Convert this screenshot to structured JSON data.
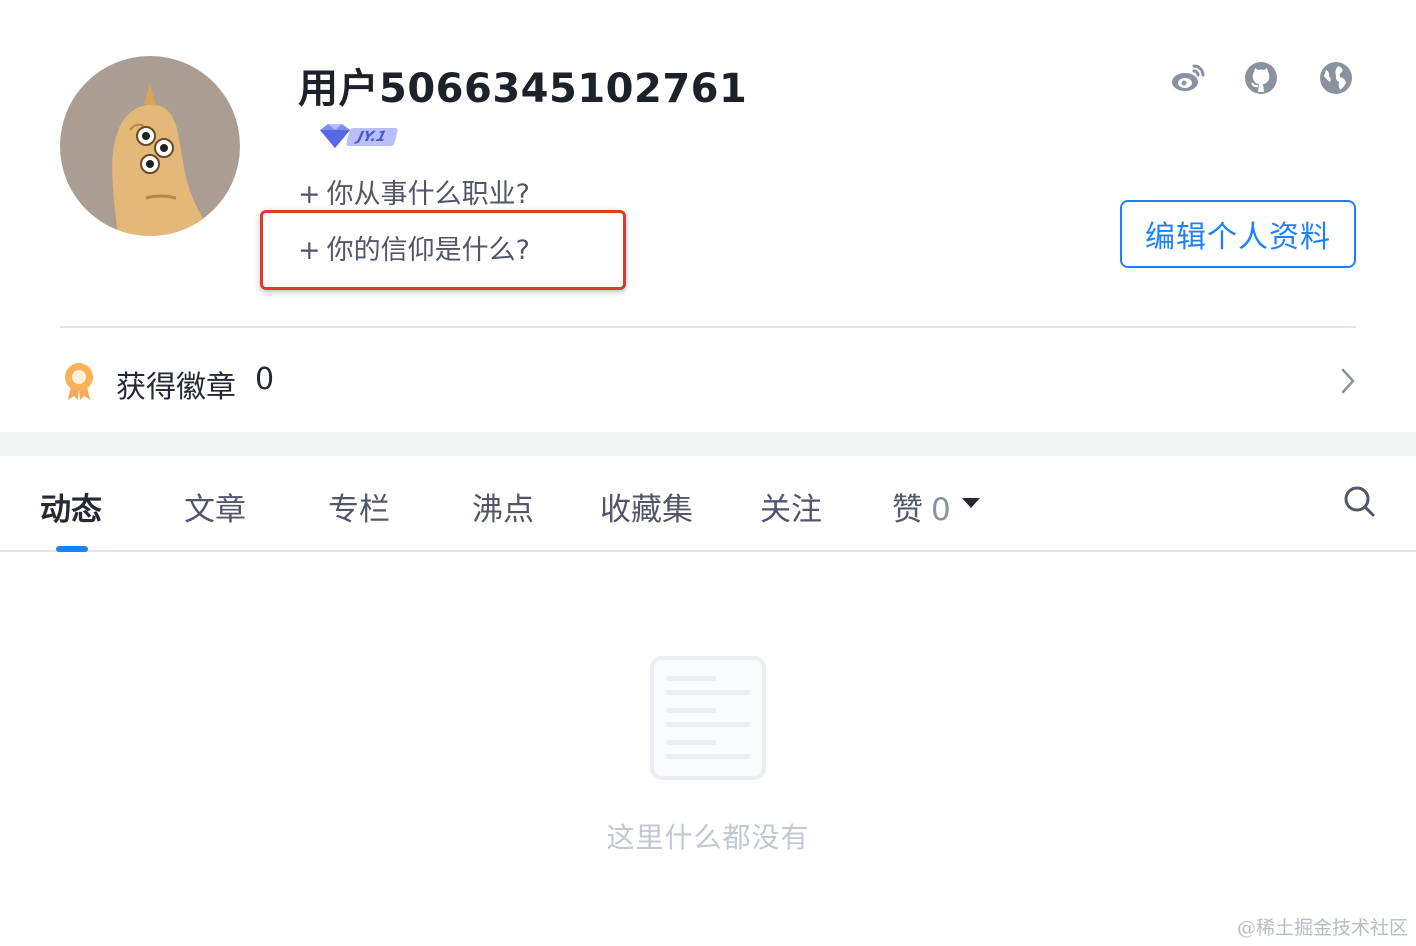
{
  "profile": {
    "username": "用户5066345102761",
    "level": "JY.1",
    "job_prompt": "你从事什么职业?",
    "belief_prompt": "你的信仰是什么?",
    "plus": "+",
    "edit_button": "编辑个人资料",
    "social_icons": [
      "weibo-icon",
      "github-icon",
      "globe-icon"
    ]
  },
  "badges": {
    "label": "获得徽章",
    "count": "0"
  },
  "tabs": {
    "items": [
      "动态",
      "文章",
      "专栏",
      "沸点",
      "收藏集",
      "关注",
      "赞"
    ],
    "active": "动态",
    "like_count": "0"
  },
  "empty": {
    "text": "这里什么都没有"
  },
  "watermark": "@稀土掘金技术社区",
  "colors": {
    "accent": "#1e80ff",
    "highlight": "#e0392e",
    "text_primary": "#252933",
    "text_secondary": "#515767"
  }
}
